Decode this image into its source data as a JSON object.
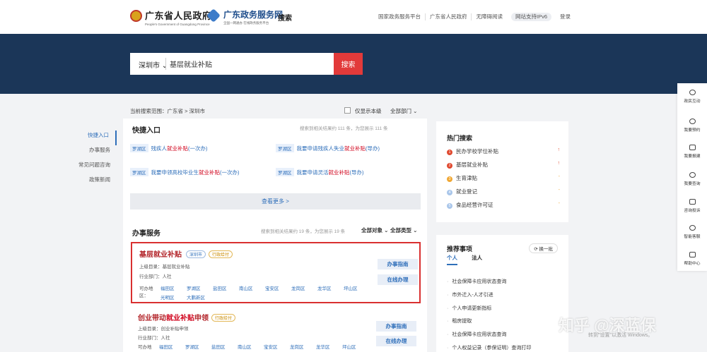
{
  "header": {
    "gov_name": "广东省人民政府",
    "gov_subtitle": "People's Government of Guangdong Province",
    "service_name": "广东政务服务网",
    "service_subtitle": "全国一网通办 在线政务服务平台",
    "search_label": "搜索",
    "links": [
      "国家政务服务平台",
      "广东省人民政府",
      "无障碍阅读",
      "网站支持IPv6",
      "登录"
    ]
  },
  "search": {
    "city": "深圳市",
    "query": "基层就业补贴",
    "button": "搜索"
  },
  "scope": {
    "text": "当前搜索范围：广东省 > 深圳市",
    "sample_only": "仅显示本级",
    "dept_select": "全部部门"
  },
  "left_nav": [
    "快捷入口",
    "办事服务",
    "常见问题咨询",
    "政策新闻"
  ],
  "quick": {
    "title": "快捷入口",
    "meta": "搜索到相关结果约 111 条，为您展示 111 条",
    "items": [
      {
        "area": "罗湖区",
        "pre": "残疾人",
        "hl": "就业补贴",
        "post": "(一次办)"
      },
      {
        "area": "罗湖区",
        "pre": "我要申请残疾人失业",
        "hl": "就业补贴",
        "post": "(导办)"
      },
      {
        "area": "罗湖区",
        "pre": "我要申领高校毕业生",
        "hl": "就业补贴",
        "post": "(一次办)"
      },
      {
        "area": "罗湖区",
        "pre": "我要申请灵活",
        "hl": "就业补贴",
        "post": "(导办)"
      }
    ],
    "more": "查看更多 >"
  },
  "services": {
    "title": "办事服务",
    "meta": "搜索到相关结果约 19 条，为您展示 19 条",
    "filter_object": "全部对象",
    "filter_type": "全部类型",
    "cards": [
      {
        "title_pre": "",
        "title_hl": "基层就业补贴",
        "title_post": "",
        "city_tag": "深圳市",
        "type_tag": "行政给付",
        "parent": "上级目录：基层就业补贴",
        "dept": "行业部门：人社",
        "area_label": "可办地区：",
        "districts": [
          "福田区",
          "罗湖区",
          "盐田区",
          "南山区",
          "宝安区",
          "龙岗区",
          "龙华区",
          "坪山区",
          "光明区",
          "大鹏新区"
        ],
        "btn_guide": "办事指南",
        "btn_online": "在线办理"
      },
      {
        "title_pre": "创业带动",
        "title_hl": "就业补贴",
        "title_post": "申领",
        "city_tag": "",
        "type_tag": "行政给付",
        "parent": "上级目录：创业补贴申领",
        "dept": "行业部门：人社",
        "area_label": "可办地区：",
        "districts": [
          "福田区",
          "罗湖区",
          "盐田区",
          "南山区",
          "宝安区",
          "龙岗区",
          "龙华区",
          "坪山区"
        ],
        "btn_guide": "办事指南",
        "btn_online": "在线办理"
      }
    ]
  },
  "hot": {
    "title": "热门搜索",
    "items": [
      {
        "num": "1",
        "text": "民办学校学位补贴",
        "trend": "↑",
        "color": "#e0492f"
      },
      {
        "num": "2",
        "text": "基层就业补贴",
        "trend": "↑",
        "color": "#e0492f"
      },
      {
        "num": "3",
        "text": "生育津贴",
        "trend": "-",
        "color": "#f0a733"
      },
      {
        "num": "4",
        "text": "就业登记",
        "trend": "-",
        "color": "#a9c6ea"
      },
      {
        "num": "5",
        "text": "食品经营许可证",
        "trend": "-",
        "color": "#a9c6ea"
      }
    ]
  },
  "recommend": {
    "title": "推荐事项",
    "refresh": "换一批",
    "tabs": [
      "个人",
      "法人"
    ],
    "items": [
      "社会保障卡应用状态查询",
      "市外迁入-人才引进",
      "个人申请更新指标",
      "租房提取",
      "社会保障卡应用状态查询",
      "个人权益记录（参保证明）查询打印"
    ]
  },
  "float_bar": [
    "政民互动",
    "我要预约",
    "我要报建",
    "我要查询",
    "咨询投诉",
    "智能客服",
    "帮助中心"
  ],
  "watermark": "知乎 @深蓝保",
  "os_watermark": "转到\"设置\"以激活 Windows。"
}
